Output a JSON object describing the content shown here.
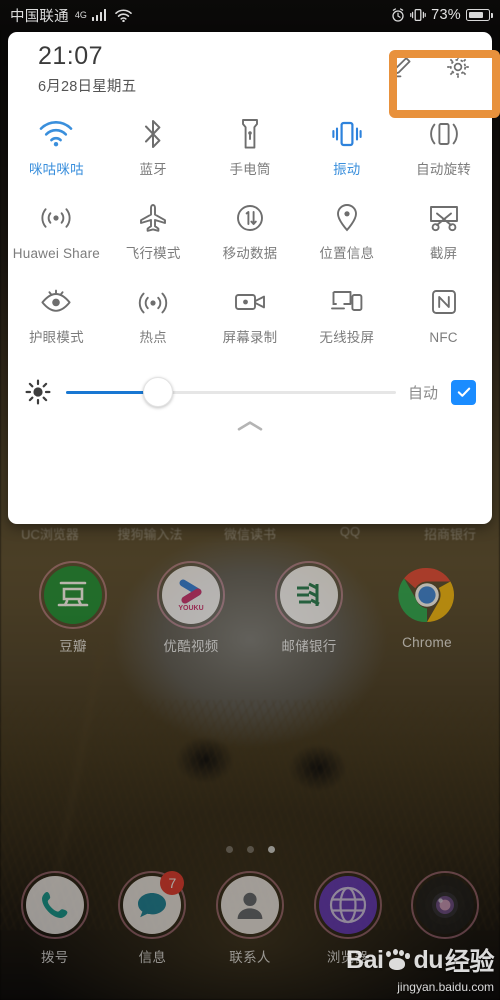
{
  "status_bar": {
    "carrier": "中国联通",
    "network": "4G",
    "signal_icon": "signal-bars-icon",
    "wifi_icon": "wifi-icon",
    "alarm_icon": "alarm-clock-icon",
    "vibrate_icon": "vibrate-icon",
    "battery_percent": "73%",
    "battery_icon": "battery-icon"
  },
  "shade": {
    "time": "21:07",
    "date": "6月28日星期五",
    "edit_icon": "pencil-edit-icon",
    "settings_icon": "gear-icon",
    "collapse_icon": "chevron-up-icon",
    "highlight_color": "#e8913c",
    "active_color": "#3a8fdc",
    "inactive_color": "#7c7c7c",
    "tiles": [
      {
        "label": "咪咕咪咕",
        "icon": "wifi-icon",
        "active": true
      },
      {
        "label": "蓝牙",
        "icon": "bluetooth-icon",
        "active": false
      },
      {
        "label": "手电筒",
        "icon": "flashlight-icon",
        "active": false
      },
      {
        "label": "振动",
        "icon": "vibrate-icon",
        "active": true
      },
      {
        "label": "自动旋转",
        "icon": "auto-rotate-icon",
        "active": false
      },
      {
        "label": "Huawei Share",
        "icon": "huawei-share-icon",
        "active": false
      },
      {
        "label": "飞行模式",
        "icon": "airplane-icon",
        "active": false
      },
      {
        "label": "移动数据",
        "icon": "mobile-data-icon",
        "active": false
      },
      {
        "label": "位置信息",
        "icon": "location-pin-icon",
        "active": false
      },
      {
        "label": "截屏",
        "icon": "screenshot-icon",
        "active": false
      },
      {
        "label": "护眼模式",
        "icon": "eye-comfort-icon",
        "active": false
      },
      {
        "label": "热点",
        "icon": "hotspot-icon",
        "active": false
      },
      {
        "label": "屏幕录制",
        "icon": "screen-record-icon",
        "active": false
      },
      {
        "label": "无线投屏",
        "icon": "wireless-projection-icon",
        "active": false
      },
      {
        "label": "NFC",
        "icon": "nfc-icon",
        "active": false
      }
    ],
    "brightness": {
      "icon": "brightness-icon",
      "value_percent": 28,
      "auto_label": "自动",
      "auto_checked": true,
      "checkbox_color": "#1a8cff",
      "fill_color": "#1877d2"
    }
  },
  "home": {
    "obscured_labels": [
      "UC浏览器",
      "搜狗输入法",
      "微信读书",
      "QQ",
      "招商银行"
    ],
    "apps": [
      {
        "label": "豆瓣",
        "icon": "douban-icon"
      },
      {
        "label": "优酷视频",
        "icon": "youku-icon"
      },
      {
        "label": "邮储银行",
        "icon": "psbc-bank-icon"
      },
      {
        "label": "Chrome",
        "icon": "chrome-icon"
      }
    ],
    "page_dots": {
      "count": 3,
      "current": 3
    },
    "dock": [
      {
        "label": "拨号",
        "icon": "phone-icon",
        "badge": ""
      },
      {
        "label": "信息",
        "icon": "message-icon",
        "badge": "7"
      },
      {
        "label": "联系人",
        "icon": "contacts-icon",
        "badge": ""
      },
      {
        "label": "浏览器",
        "icon": "browser-globe-icon",
        "badge": ""
      },
      {
        "label": "",
        "icon": "camera-icon",
        "badge": ""
      }
    ]
  },
  "watermark": {
    "brand": "Bai",
    "brand_suffix": "du",
    "cn": "经验",
    "url": "jingyan.baidu.com"
  }
}
